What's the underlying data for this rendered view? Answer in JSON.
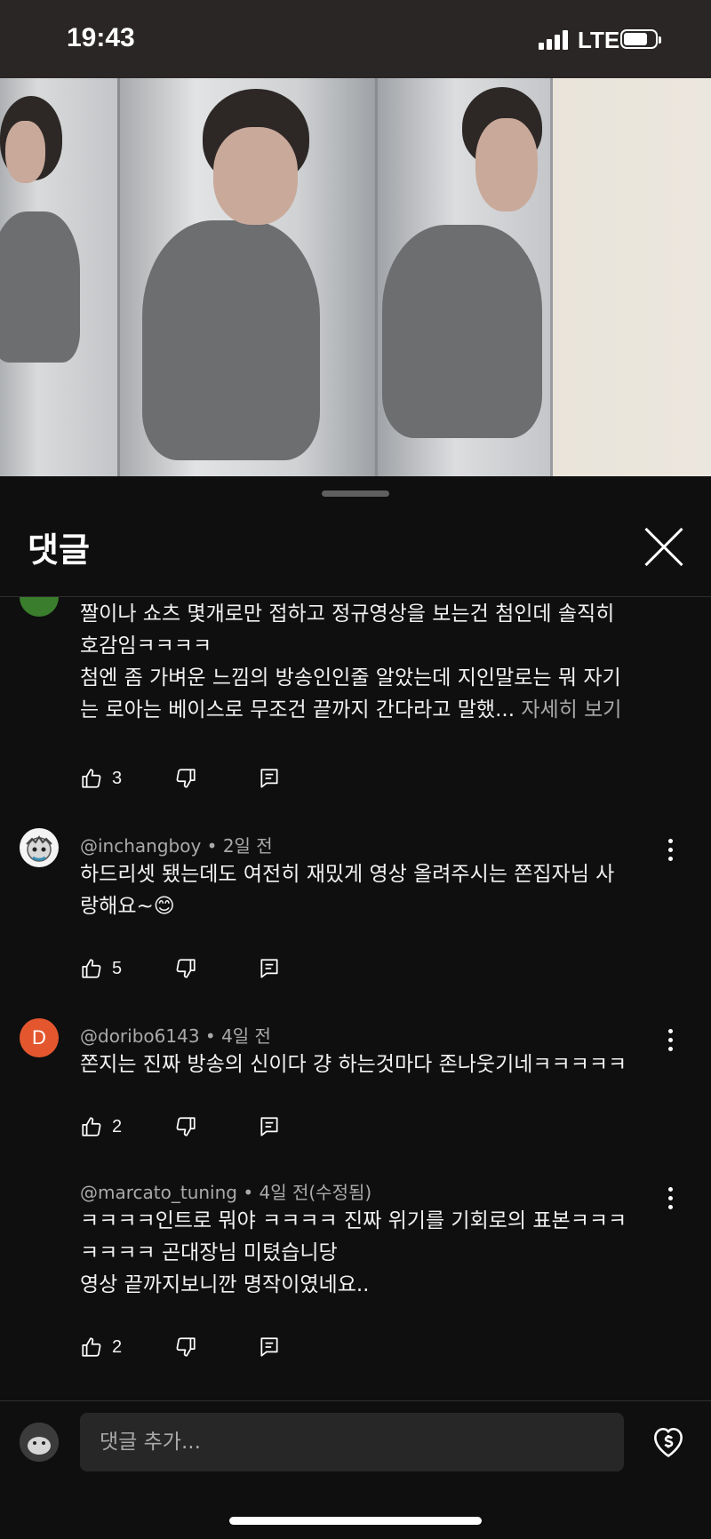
{
  "status_bar": {
    "time": "19:43",
    "network": "LTE"
  },
  "comments_panel": {
    "title": "댓글",
    "comments": [
      {
        "lines": [
          "짤이나 쇼츠 몇개로만 접하고 정규영상을 보는건 첨인데 솔직히",
          "호감임ㅋㅋㅋㅋ",
          "첨엔 좀 가벼운 느낌의 방송인인줄 알았는데 지인말로는 뭐 자기",
          "는 로아는 베이스로 무조건 끝까지 간다라고 말했..."
        ],
        "more_label": "자세히 보기",
        "likes": "3",
        "avatar_color": "#3a7d2c"
      },
      {
        "author": "@inchangboy",
        "time": "2일 전",
        "lines": [
          "하드리셋 됐는데도 여전히 재밌게 영상 올려주시는 쫀집자님 사",
          "랑해요~😊"
        ],
        "likes": "5"
      },
      {
        "author": "@doribo6143",
        "time": "4일 전",
        "avatar_letter": "D",
        "avatar_color": "#e4572e",
        "lines": [
          "쫀지는 진짜 방송의 신이다 걍 하는것마다 존나웃기네ㅋㅋㅋㅋㅋ"
        ],
        "likes": "2"
      },
      {
        "author": "@marcato_tuning",
        "time": "4일 전(수정됨)",
        "lines": [
          "ㅋㅋㅋㅋ인트로 뭐야 ㅋㅋㅋㅋ 진짜 위기를 기회로의 표본ㅋㅋㅋ",
          "ㅋㅋㅋㅋ 곤대장님 미텼습니당",
          "영상 끝까지보니깐 명작이였네요.."
        ],
        "likes": "2"
      }
    ]
  },
  "composer": {
    "placeholder": "댓글 추가..."
  },
  "icons": {
    "like": "thumbs-up-icon",
    "dislike": "thumbs-down-icon",
    "reply": "reply-comment-icon",
    "more": "more-vertical-icon",
    "close": "close-icon",
    "thanks": "super-thanks-heart-icon"
  }
}
